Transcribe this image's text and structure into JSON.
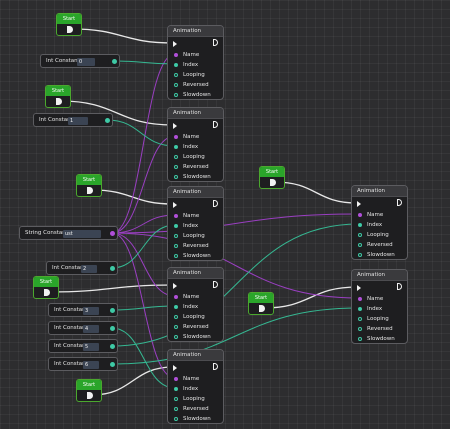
{
  "diagram": {
    "animation_nodes": [
      {
        "title": "Animation",
        "pins": [
          "Name",
          "Index",
          "Looping",
          "Reversed",
          "Slowdown"
        ]
      },
      {
        "title": "Animation",
        "pins": [
          "Name",
          "Index",
          "Looping",
          "Reversed",
          "Slowdown"
        ]
      },
      {
        "title": "Animation",
        "pins": [
          "Name",
          "Index",
          "Looping",
          "Reversed",
          "Slowdown"
        ]
      },
      {
        "title": "Animation",
        "pins": [
          "Name",
          "Index",
          "Looping",
          "Reversed",
          "Slowdown"
        ]
      },
      {
        "title": "Animation",
        "pins": [
          "Name",
          "Index",
          "Looping",
          "Reversed",
          "Slowdown"
        ]
      },
      {
        "title": "Animation",
        "pins": [
          "Name",
          "Index",
          "Looping",
          "Reversed",
          "Slowdown"
        ]
      },
      {
        "title": "Animation",
        "pins": [
          "Name",
          "Index",
          "Looping",
          "Reversed",
          "Slowdown"
        ]
      }
    ],
    "start_nodes": [
      {
        "label": "Start"
      },
      {
        "label": "Start"
      },
      {
        "label": "Start"
      },
      {
        "label": "Start"
      },
      {
        "label": "Start"
      },
      {
        "label": "Start"
      },
      {
        "label": "Start"
      }
    ],
    "constants": [
      {
        "label": "Int Constant",
        "value": "0",
        "pin": "teal"
      },
      {
        "label": "Int Constant",
        "value": "1",
        "pin": "teal"
      },
      {
        "label": "String Constant",
        "value": "ust",
        "pin": "purple"
      },
      {
        "label": "Int Constant",
        "value": "2",
        "pin": "teal"
      },
      {
        "label": "Int Constant",
        "value": "3",
        "pin": "teal"
      },
      {
        "label": "Int Constant",
        "value": "4",
        "pin": "teal"
      },
      {
        "label": "Int Constant",
        "value": "5",
        "pin": "teal"
      },
      {
        "label": "Int Constant",
        "value": "6",
        "pin": "teal"
      }
    ],
    "colors": {
      "flow_wire": "#e8e8e8",
      "string_wire": "#9a3fc2",
      "int_wire": "#35b892",
      "start_header": "#2aa52a"
    }
  }
}
